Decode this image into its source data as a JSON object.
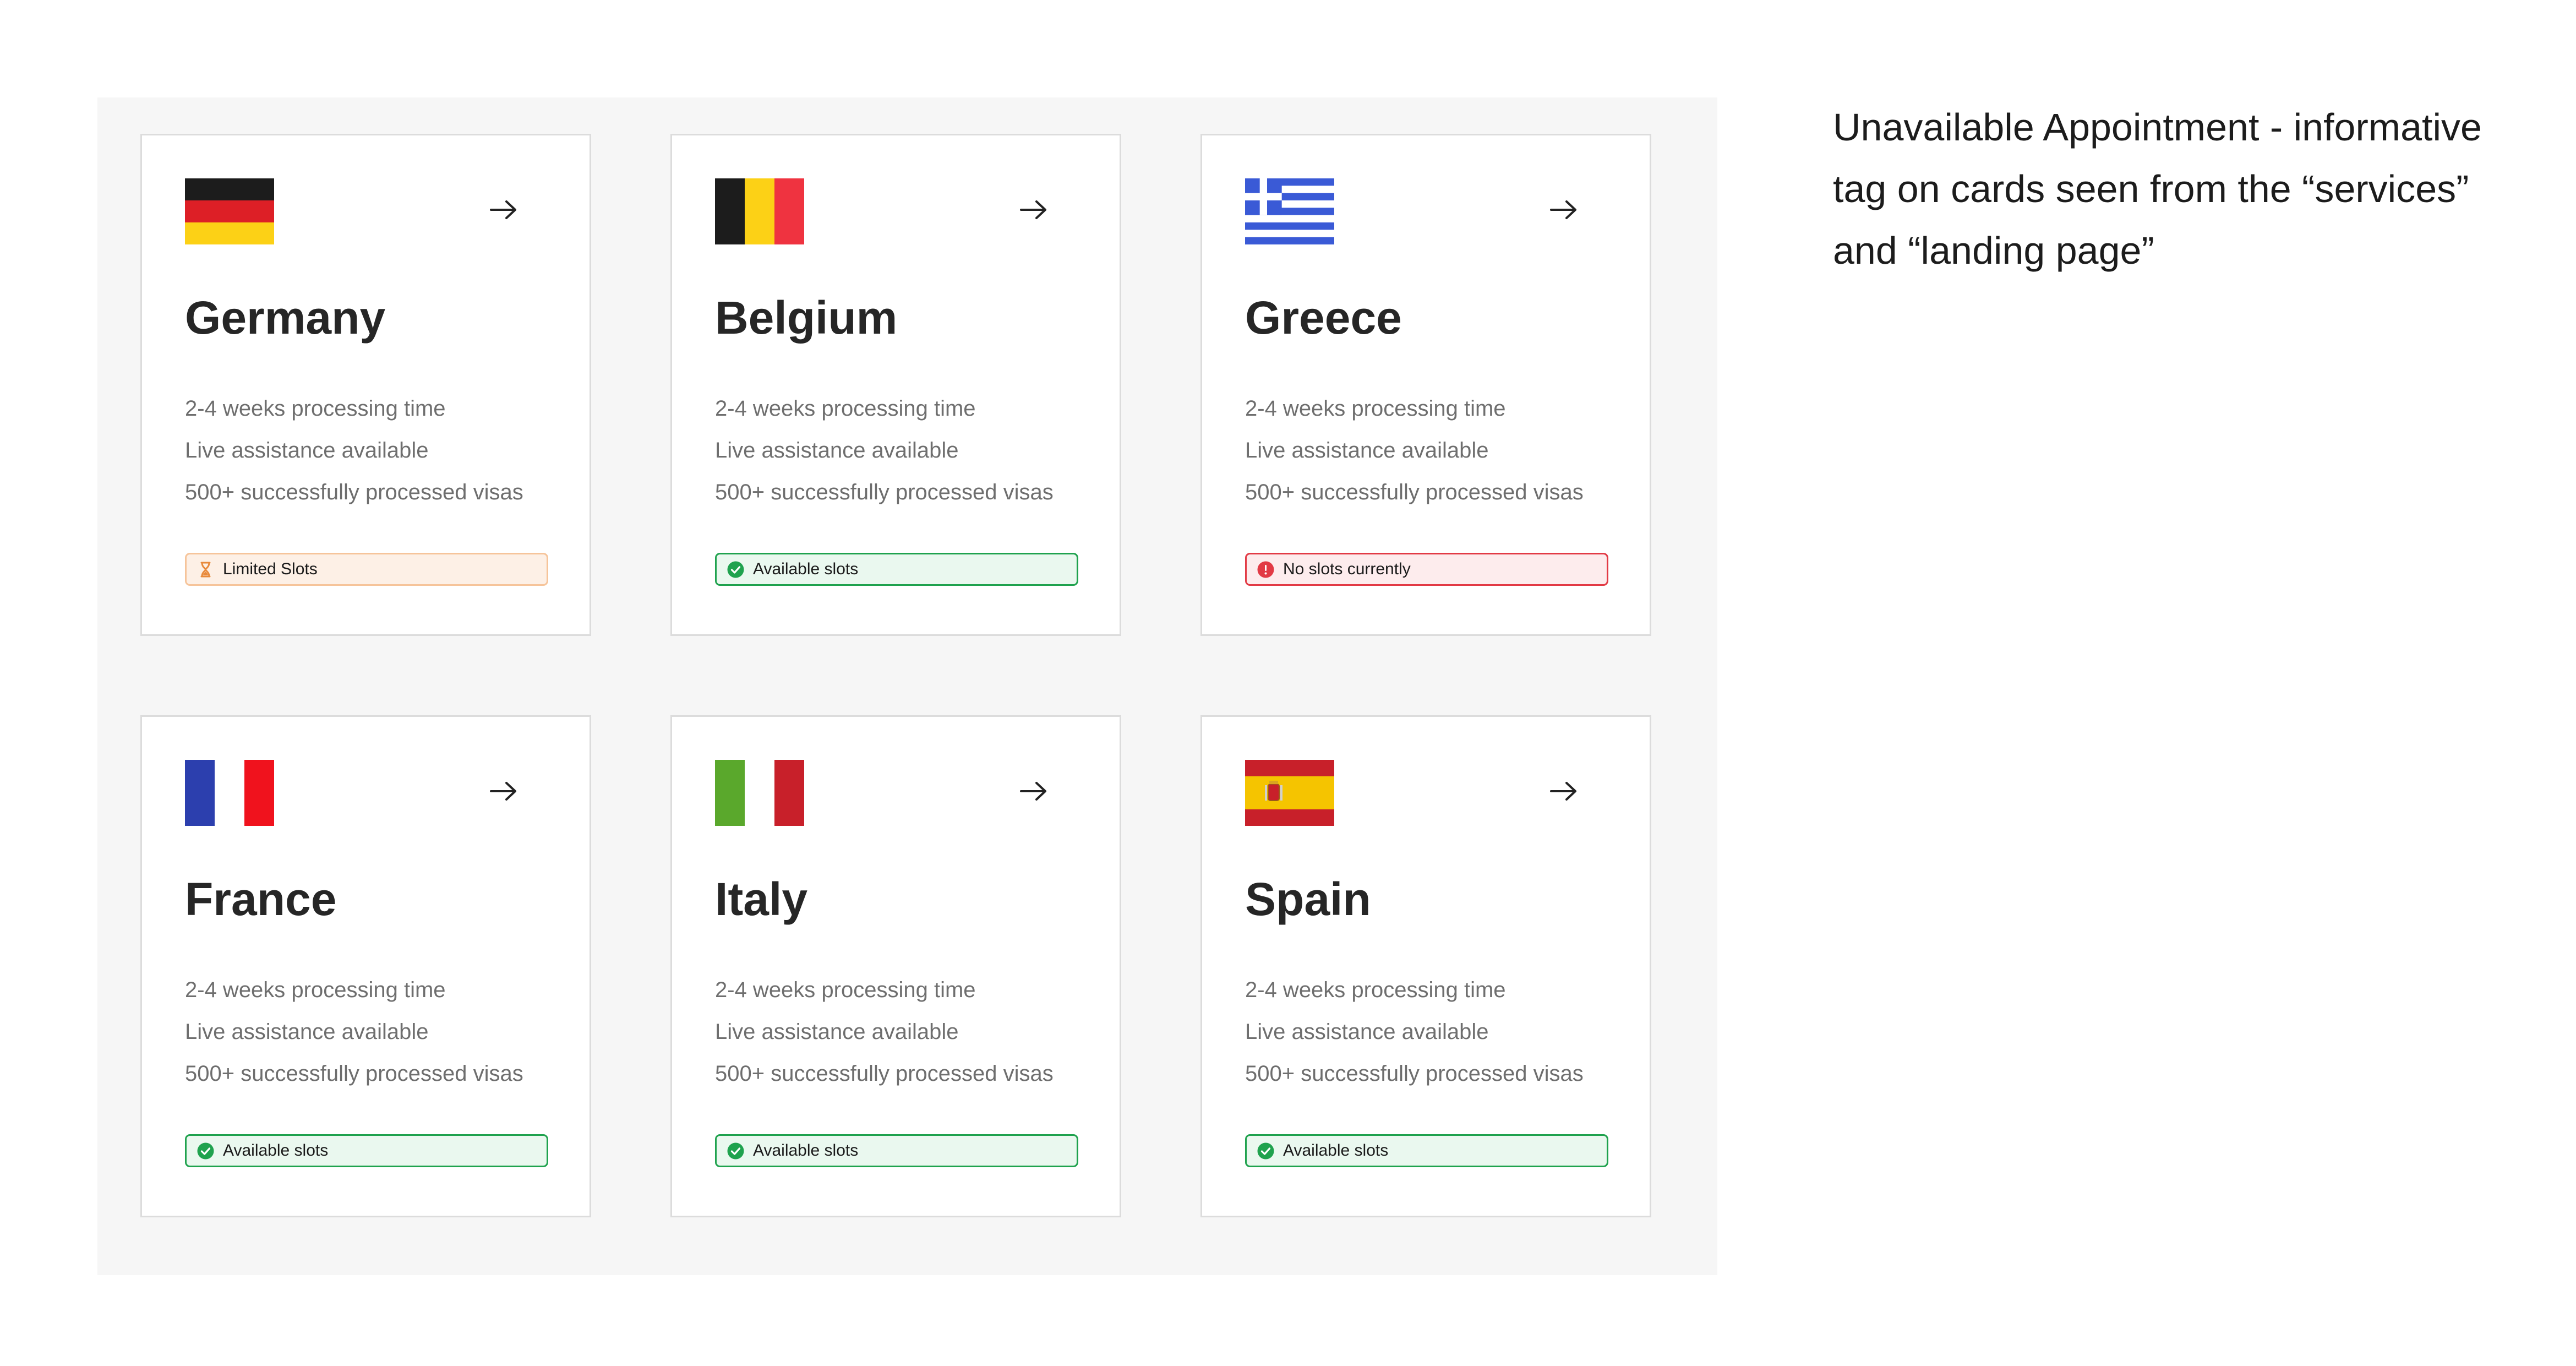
{
  "cards": [
    {
      "country": "Germany",
      "flag_icon": "germany-flag-icon",
      "features": [
        "2-4 weeks processing time",
        "Live assistance available",
        "500+ successfully processed visas"
      ],
      "status": {
        "type": "warning",
        "label": "Limited Slots",
        "icon": "hourglass-icon"
      }
    },
    {
      "country": "Belgium",
      "flag_icon": "belgium-flag-icon",
      "features": [
        "2-4 weeks processing time",
        "Live assistance available",
        "500+ successfully processed visas"
      ],
      "status": {
        "type": "success",
        "label": "Available slots",
        "icon": "check-circle-icon"
      }
    },
    {
      "country": "Greece",
      "flag_icon": "greece-flag-icon",
      "features": [
        "2-4 weeks processing time",
        "Live assistance available",
        "500+ successfully processed visas"
      ],
      "status": {
        "type": "error",
        "label": "No slots currently",
        "icon": "alert-circle-icon"
      }
    },
    {
      "country": "France",
      "flag_icon": "france-flag-icon",
      "features": [
        "2-4 weeks processing time",
        "Live assistance available",
        "500+ successfully processed visas"
      ],
      "status": {
        "type": "success",
        "label": "Available slots",
        "icon": "check-circle-icon"
      }
    },
    {
      "country": "Italy",
      "flag_icon": "italy-flag-icon",
      "features": [
        "2-4 weeks processing time",
        "Live assistance available",
        "500+ successfully processed visas"
      ],
      "status": {
        "type": "success",
        "label": "Available slots",
        "icon": "check-circle-icon"
      }
    },
    {
      "country": "Spain",
      "flag_icon": "spain-flag-icon",
      "features": [
        "2-4 weeks processing time",
        "Live assistance available",
        "500+ successfully processed visas"
      ],
      "status": {
        "type": "success",
        "label": "Available slots",
        "icon": "check-circle-icon"
      }
    }
  ],
  "side_note": "Unavailable Appointment - informative tag on cards seen from the “services” and “landing page”",
  "colors": {
    "warning": "#e88a3c",
    "success": "#1fa24e",
    "error": "#e23a45",
    "panel": "#f6f6f6"
  }
}
